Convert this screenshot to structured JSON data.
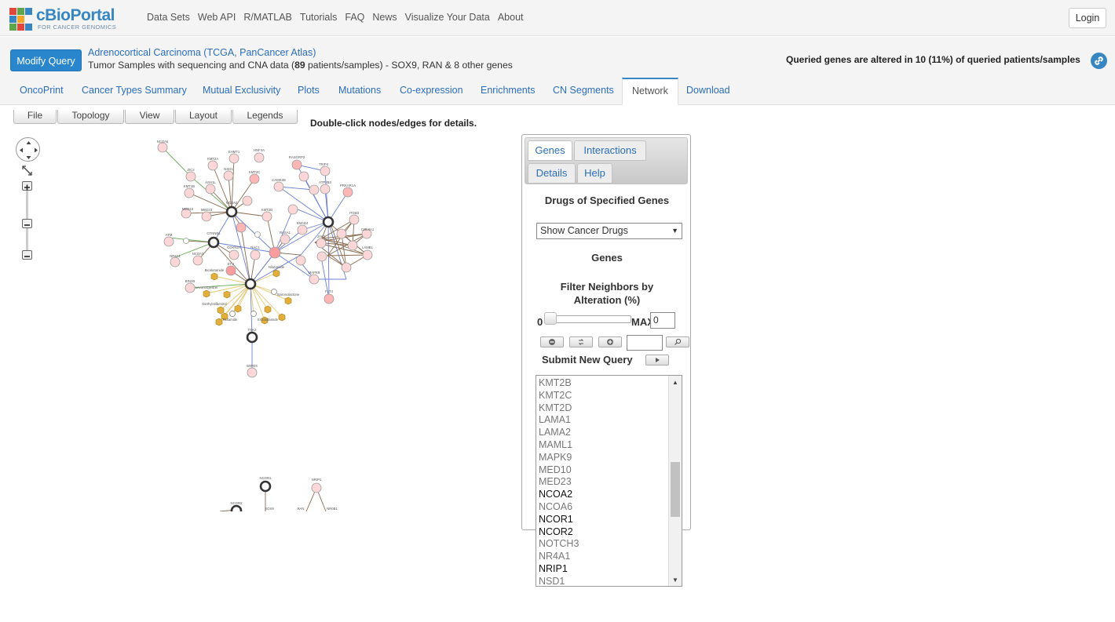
{
  "app": {
    "logo_text": "cBioPortal",
    "logo_sub": "FOR CANCER GENOMICS",
    "nav": [
      "Data Sets",
      "Web API",
      "R/MATLAB",
      "Tutorials",
      "FAQ",
      "News",
      "Visualize Your Data",
      "About"
    ],
    "login_label": "Login",
    "colors": {
      "brand": "#3786c2",
      "link": "#2a6ebb",
      "primary_button": "#2986cc"
    }
  },
  "query": {
    "modify_label": "Modify Query",
    "study_title": "Adrenocortical Carcinoma (TCGA, PanCancer Atlas)",
    "desc_prefix": "Tumor Samples with sequencing and CNA data (",
    "desc_count": "89",
    "desc_suffix": " patients/samples)  - SOX9, RAN & 8 other genes",
    "altered_summary": "Queried genes are altered in 10 (11%) of queried patients/samples",
    "share_icon": "link-icon"
  },
  "tabs": [
    "OncoPrint",
    "Cancer Types Summary",
    "Mutual Exclusivity",
    "Plots",
    "Mutations",
    "Co-expression",
    "Enrichments",
    "CN Segments",
    "Network",
    "Download"
  ],
  "active_tab": "Network",
  "network": {
    "menus": [
      "File",
      "Topology",
      "View",
      "Layout",
      "Legends"
    ],
    "hint": "Double-click nodes/edges for details.",
    "labels": {
      "ncoa6": "NCOA6",
      "kmt2a": "KMT2A",
      "ehmt1": "EHMT1",
      "hnf4a": "HNF4A",
      "rasgrp2": "RASGRP2",
      "trip4": "TRIP4",
      "zic2": "ZIC2",
      "ash1l": "ASH1L",
      "nsd1": "NSD1",
      "kmt2c": "KMT2C",
      "camk2b": "CAMK2B",
      "atp2b3": "ATP2B3",
      "kmt2b": "KMT2B",
      "prkar1a": "PRKAR1A",
      "med10": "MED10",
      "med23": "MED23",
      "ncoa2": "NCOA2",
      "kmt2d": "KMT2D",
      "itgb3": "ITGB3",
      "atm": "ATM",
      "smad4": "SMAD4",
      "col4a1": "COL4A1",
      "ctnnb1": "CTNNB1",
      "cdkn2a": "CDKN2A",
      "rac1": "RAC1",
      "nr4a1": "NR4A1",
      "ncoa1": "NCOA1",
      "rasa1": "RASA1",
      "jak2": "JAK2",
      "lamb1": "LAMB1",
      "etv": "ETV",
      "mapk9": "MAPK9",
      "bin2b": "BIN2B",
      "drug1": "Bicalutamide",
      "drug2": "Nilutamide",
      "drug3": "Levonorgestrel",
      "drug4": "Diethylstilbestrol",
      "drug5": "Spironolactone",
      "drug6": "Flutamide",
      "drug7": "Enzalutamide",
      "flt4": "FLT4",
      "ncor1": "NCOR1",
      "nrip1": "NRIP1",
      "ncor2": "NCOR2",
      "nr0b1": "NR0B1",
      "wwox": "WWOX",
      "sox9": "SOX9",
      "ran": "RAN",
      "tnk2": "TNK2"
    }
  },
  "panel": {
    "tabs": [
      "Genes",
      "Interactions",
      "Details",
      "Help"
    ],
    "active": "Genes",
    "drugs_heading": "Drugs of Specified Genes",
    "drug_select": "Show Cancer Drugs",
    "genes_heading": "Genes",
    "filter_heading_1": "Filter Neighbors by",
    "filter_heading_2": "Alteration (%)",
    "slider_min": "0",
    "slider_max_label": "MAX",
    "slider_max_value": "0",
    "submit_label": "Submit New Query"
  },
  "gene_list": [
    {
      "name": "KMT2B",
      "selected": false
    },
    {
      "name": "KMT2C",
      "selected": false
    },
    {
      "name": "KMT2D",
      "selected": false
    },
    {
      "name": "LAMA1",
      "selected": false
    },
    {
      "name": "LAMA2",
      "selected": false
    },
    {
      "name": "MAML1",
      "selected": false
    },
    {
      "name": "MAPK9",
      "selected": false
    },
    {
      "name": "MED10",
      "selected": false
    },
    {
      "name": "MED23",
      "selected": false
    },
    {
      "name": "NCOA2",
      "selected": true
    },
    {
      "name": "NCOA6",
      "selected": false
    },
    {
      "name": "NCOR1",
      "selected": true
    },
    {
      "name": "NCOR2",
      "selected": true
    },
    {
      "name": "NOTCH3",
      "selected": false
    },
    {
      "name": "NR4A1",
      "selected": false
    },
    {
      "name": "NRIP1",
      "selected": true
    },
    {
      "name": "NSD1",
      "selected": false
    }
  ]
}
